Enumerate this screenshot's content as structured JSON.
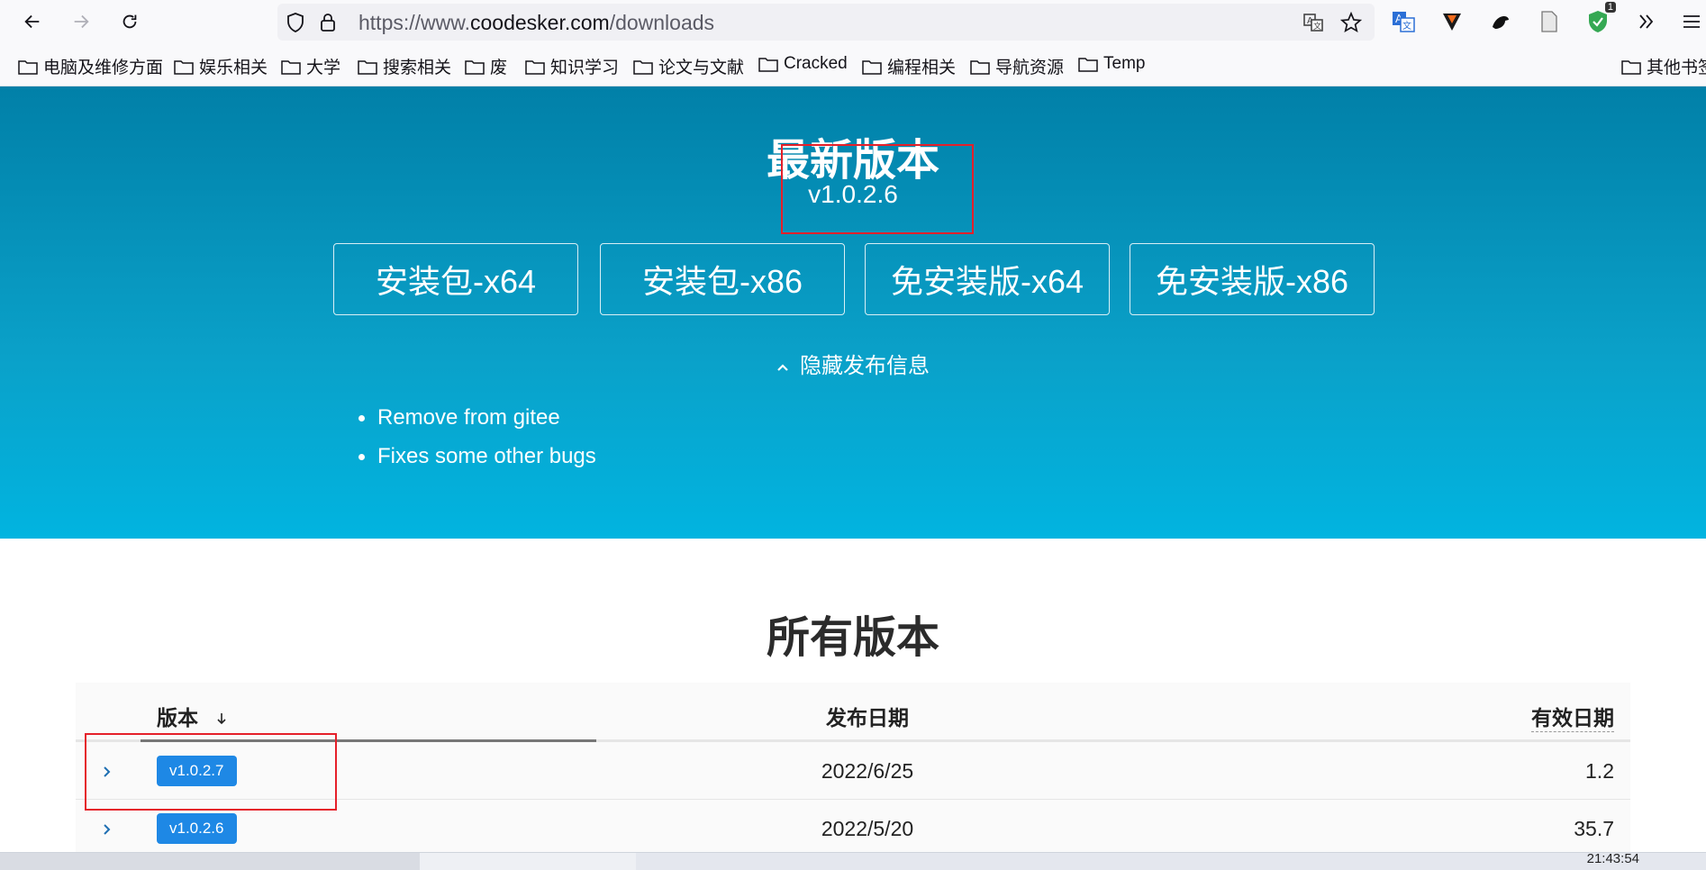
{
  "browser": {
    "url_prefix": "https://www.",
    "url_host": "coodesker.com",
    "url_path": "/downloads"
  },
  "bookmarks": [
    {
      "label": "电脑及维修方面"
    },
    {
      "label": "娱乐相关"
    },
    {
      "label": "大学"
    },
    {
      "label": "搜索相关"
    },
    {
      "label": "废"
    },
    {
      "label": "知识学习"
    },
    {
      "label": "论文与文献"
    },
    {
      "label": "Cracked"
    },
    {
      "label": "编程相关"
    },
    {
      "label": "导航资源"
    },
    {
      "label": "Temp"
    },
    {
      "label": "其他书签"
    }
  ],
  "extensions": {
    "badge_count": "1"
  },
  "latest": {
    "title": "最新版本",
    "version": "v1.0.2.6",
    "buttons": [
      "安装包-x64",
      "安装包-x86",
      "免安装版-x64",
      "免安装版-x86"
    ],
    "toggle_label": "隐藏发布信息",
    "notes": [
      "Remove from gitee",
      "Fixes some other bugs"
    ]
  },
  "all_versions": {
    "title": "所有版本",
    "columns": {
      "version": "版本",
      "date": "发布日期",
      "valid": "有效日期"
    },
    "rows": [
      {
        "version": "v1.0.2.7",
        "date": "2022/6/25",
        "valid": "1.2"
      },
      {
        "version": "v1.0.2.6",
        "date": "2022/5/20",
        "valid": "35.7"
      }
    ]
  },
  "taskbar": {
    "clock": "21:43:54"
  },
  "colors": {
    "hero_top": "#0180a8",
    "hero_bottom": "#01b4e0",
    "tag": "#1e88e5",
    "highlight": "#e5202a"
  }
}
